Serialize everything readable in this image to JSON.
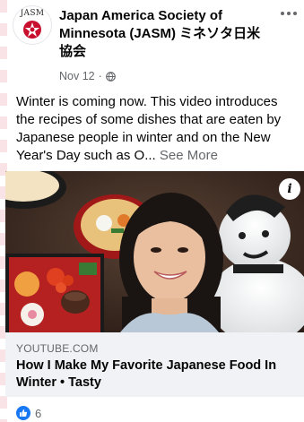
{
  "post": {
    "page_name": "Japan America Society of Minnesota (JASM) ミネソタ日米協会",
    "avatar_text": "JASM",
    "date": "Nov 12",
    "meta_separator": "·",
    "privacy_icon": "globe-icon",
    "more_icon": "more-horizontal-icon",
    "text": "Winter is coming now. This video introduces the recipes of some dishes that are eaten by Japanese people in winter and on the New Year's Day such as O...",
    "see_more": "See More"
  },
  "media": {
    "info_label": "i",
    "info_icon": "info-icon"
  },
  "link_preview": {
    "source": "YOUTUBE.COM",
    "title": "How I Make My Favorite Japanese Food In Winter • Tasty"
  },
  "reactions": {
    "icon": "thumbs-up-icon",
    "count": "6",
    "color": "#1877f2"
  },
  "colors": {
    "text_primary": "#050505",
    "text_secondary": "#65676b",
    "card_background": "#f0f2f5",
    "brand_blue": "#1877f2",
    "jasm_red": "#c8102e"
  }
}
